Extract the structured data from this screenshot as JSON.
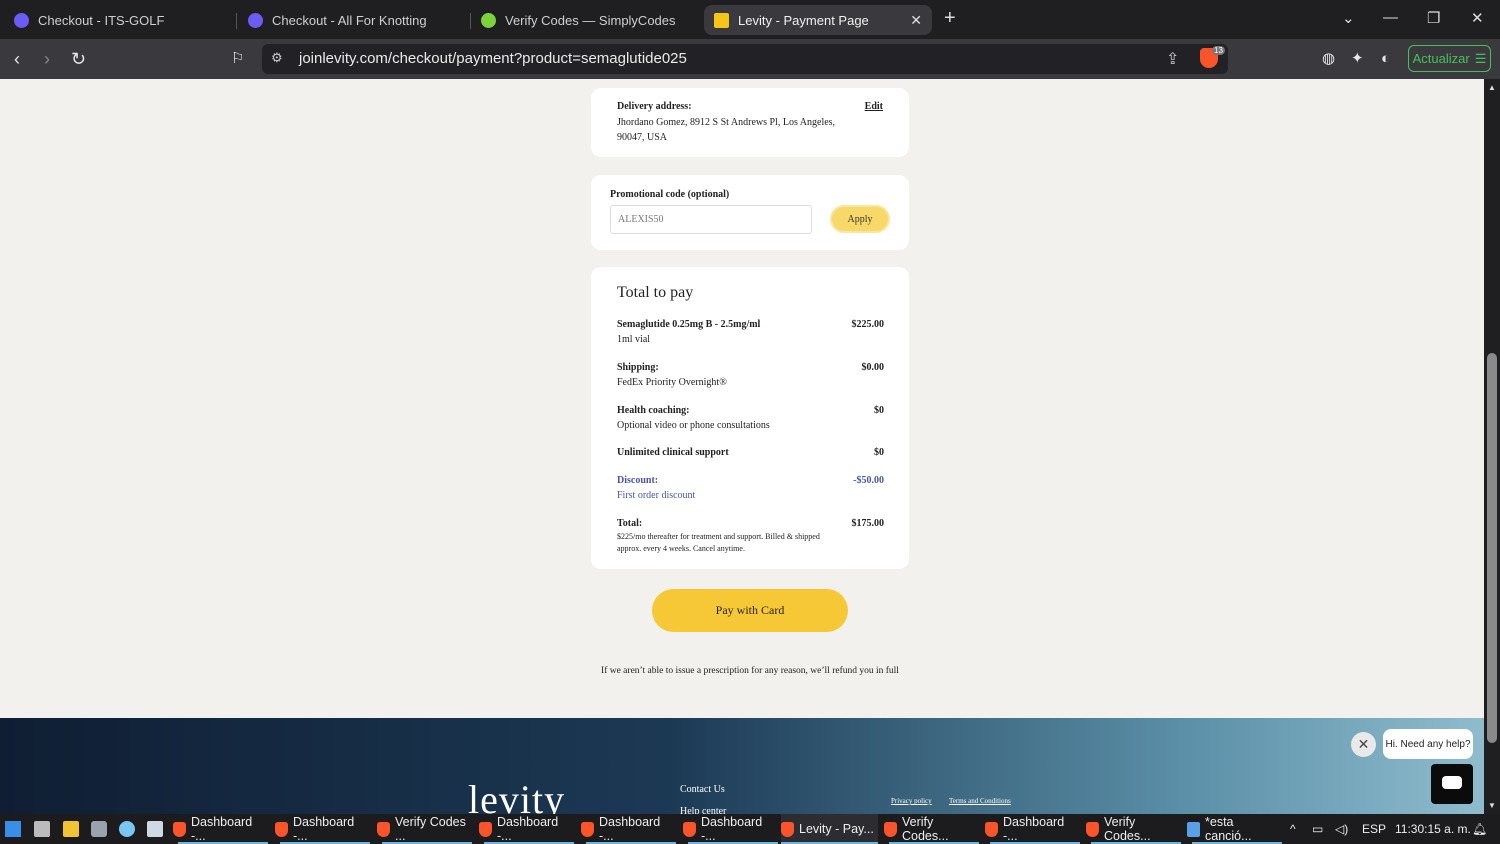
{
  "browser": {
    "tabs": [
      {
        "title": "Checkout - ITS-GOLF",
        "icon": "checkout-icon",
        "color": "#6b5cf5"
      },
      {
        "title": "Checkout - All For Knotting",
        "icon": "checkout-icon",
        "color": "#6b5cf5"
      },
      {
        "title": "Verify Codes — SimplyCodes",
        "icon": "simplycodes-icon",
        "color": "#7bd23c"
      },
      {
        "title": "Levity - Payment Page",
        "icon": "levity-icon",
        "color": "#f5c518"
      }
    ],
    "close_tab": "✕",
    "new_tab": "+",
    "url": "joinlevity.com/checkout/payment?product=semaglutide025",
    "brave_count": "13",
    "update_label": "Actualizar"
  },
  "delivery": {
    "title": "Delivery address:",
    "edit": "Edit",
    "address": "Jhordano Gomez, 8912 S St Andrews Pl, Los Angeles, 90047, USA"
  },
  "promo": {
    "label": "Promotional code (optional)",
    "value": "ALEXIS50",
    "apply": "Apply"
  },
  "total": {
    "title": "Total to pay",
    "product_name": "Semaglutide 0.25mg B - 2.5mg/ml",
    "product_sub": "1ml vial",
    "product_amt": "$225.00",
    "shipping_name": "Shipping:",
    "shipping_sub": "FedEx Priority Overnight®",
    "shipping_amt": "$0.00",
    "coaching_name": "Health coaching:",
    "coaching_sub": "Optional video or phone consultations",
    "coaching_amt": "$0",
    "support_name": "Unlimited clinical support",
    "support_amt": "$0",
    "discount_name": "Discount:",
    "discount_sub": "First order discount",
    "discount_amt": "-$50.00",
    "total_name": "Total:",
    "total_sub": "$225/mo thereafter for treatment and support. Billed & shipped approx. every 4 weeks. Cancel anytime.",
    "total_amt": "$175.00"
  },
  "pay_button": "Pay with Card",
  "refund_note": "If we aren’t able to issue a prescription for any reason, we’ll refund you in full",
  "footer": {
    "logo": "levity",
    "contact": "Contact Us",
    "help": "Help center",
    "privacy": "Privacy policy",
    "terms": "Terms and Conditions"
  },
  "chat": {
    "bubble": "Hi. Need any help?",
    "close": "✕"
  },
  "taskbar": {
    "items": [
      {
        "label": "Dashboard -..."
      },
      {
        "label": "Dashboard -..."
      },
      {
        "label": "Verify Codes ..."
      },
      {
        "label": "Dashboard -..."
      },
      {
        "label": "Dashboard -..."
      },
      {
        "label": "Dashboard -..."
      },
      {
        "label": "Levity - Pay..."
      },
      {
        "label": "Verify Codes..."
      },
      {
        "label": "Dashboard -..."
      },
      {
        "label": "Verify Codes..."
      },
      {
        "label": "*esta canció..."
      }
    ],
    "language": "ESP",
    "clock": "11:30:15 a. m."
  }
}
